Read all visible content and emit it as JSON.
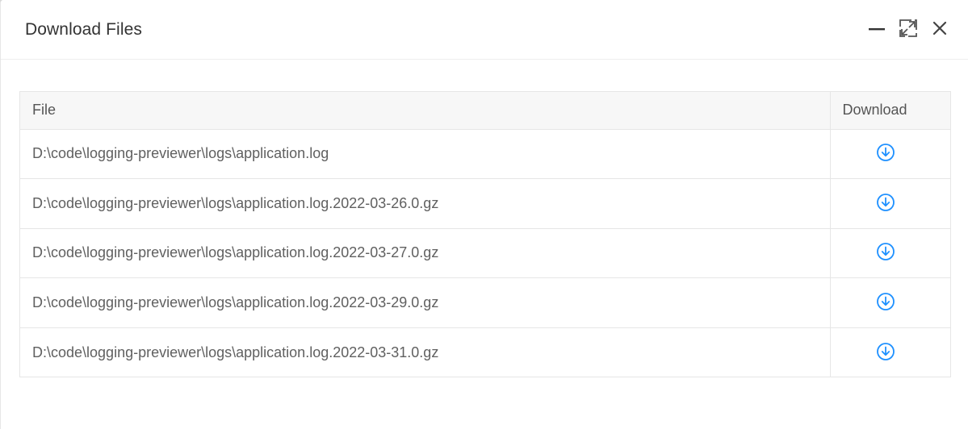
{
  "dialog": {
    "title": "Download Files"
  },
  "window_controls": {
    "minimize_icon": "minimize-icon",
    "maximize_icon": "maximize-icon",
    "close_icon": "close-icon"
  },
  "table": {
    "headers": {
      "file": "File",
      "download": "Download"
    },
    "rows": [
      {
        "file": "D:\\code\\logging-previewer\\logs\\application.log"
      },
      {
        "file": "D:\\code\\logging-previewer\\logs\\application.log.2022-03-26.0.gz"
      },
      {
        "file": "D:\\code\\logging-previewer\\logs\\application.log.2022-03-27.0.gz"
      },
      {
        "file": "D:\\code\\logging-previewer\\logs\\application.log.2022-03-29.0.gz"
      },
      {
        "file": "D:\\code\\logging-previewer\\logs\\application.log.2022-03-31.0.gz"
      }
    ],
    "download_icon": "download-circle-icon"
  },
  "colors": {
    "accent": "#1e90ff",
    "text": "#333333",
    "border": "#e6e6e6",
    "header_bg": "#f7f7f7"
  }
}
